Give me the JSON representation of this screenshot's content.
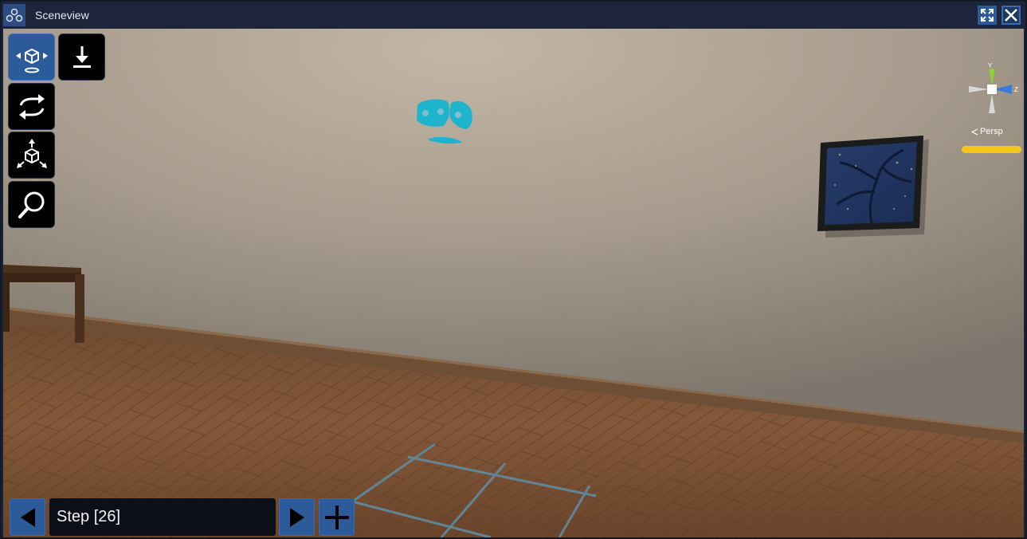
{
  "window": {
    "title": "Sceneview"
  },
  "icons": {
    "app": "cluster-icon",
    "maximize": "maximize-icon",
    "close": "close-icon"
  },
  "toolbar": {
    "tools": [
      {
        "name": "move-tool",
        "icon": "move-object-icon",
        "active": true
      },
      {
        "name": "download",
        "icon": "download-icon",
        "active": false
      },
      {
        "name": "rotate-tool",
        "icon": "rotate-icon",
        "active": false
      },
      {
        "name": "scale-tool",
        "icon": "scale-icon",
        "active": false
      },
      {
        "name": "zoom-tool",
        "icon": "magnifier-icon",
        "active": false
      }
    ]
  },
  "orientation_gizmo": {
    "y_label": "Y",
    "z_label": "Z",
    "projection_label": "Persp",
    "projection_icon": "perspective-icon"
  },
  "step_bar": {
    "prev_icon": "triangle-left-icon",
    "next_icon": "triangle-right-icon",
    "add_icon": "plus-icon",
    "step_text": "Step [26]"
  },
  "colors": {
    "accent": "#2d5b99",
    "gizmo_y": "#8dd232",
    "gizmo_z": "#3c7bdc",
    "projection_bar": "#f5c71a",
    "marker": "#1eb4cc"
  }
}
